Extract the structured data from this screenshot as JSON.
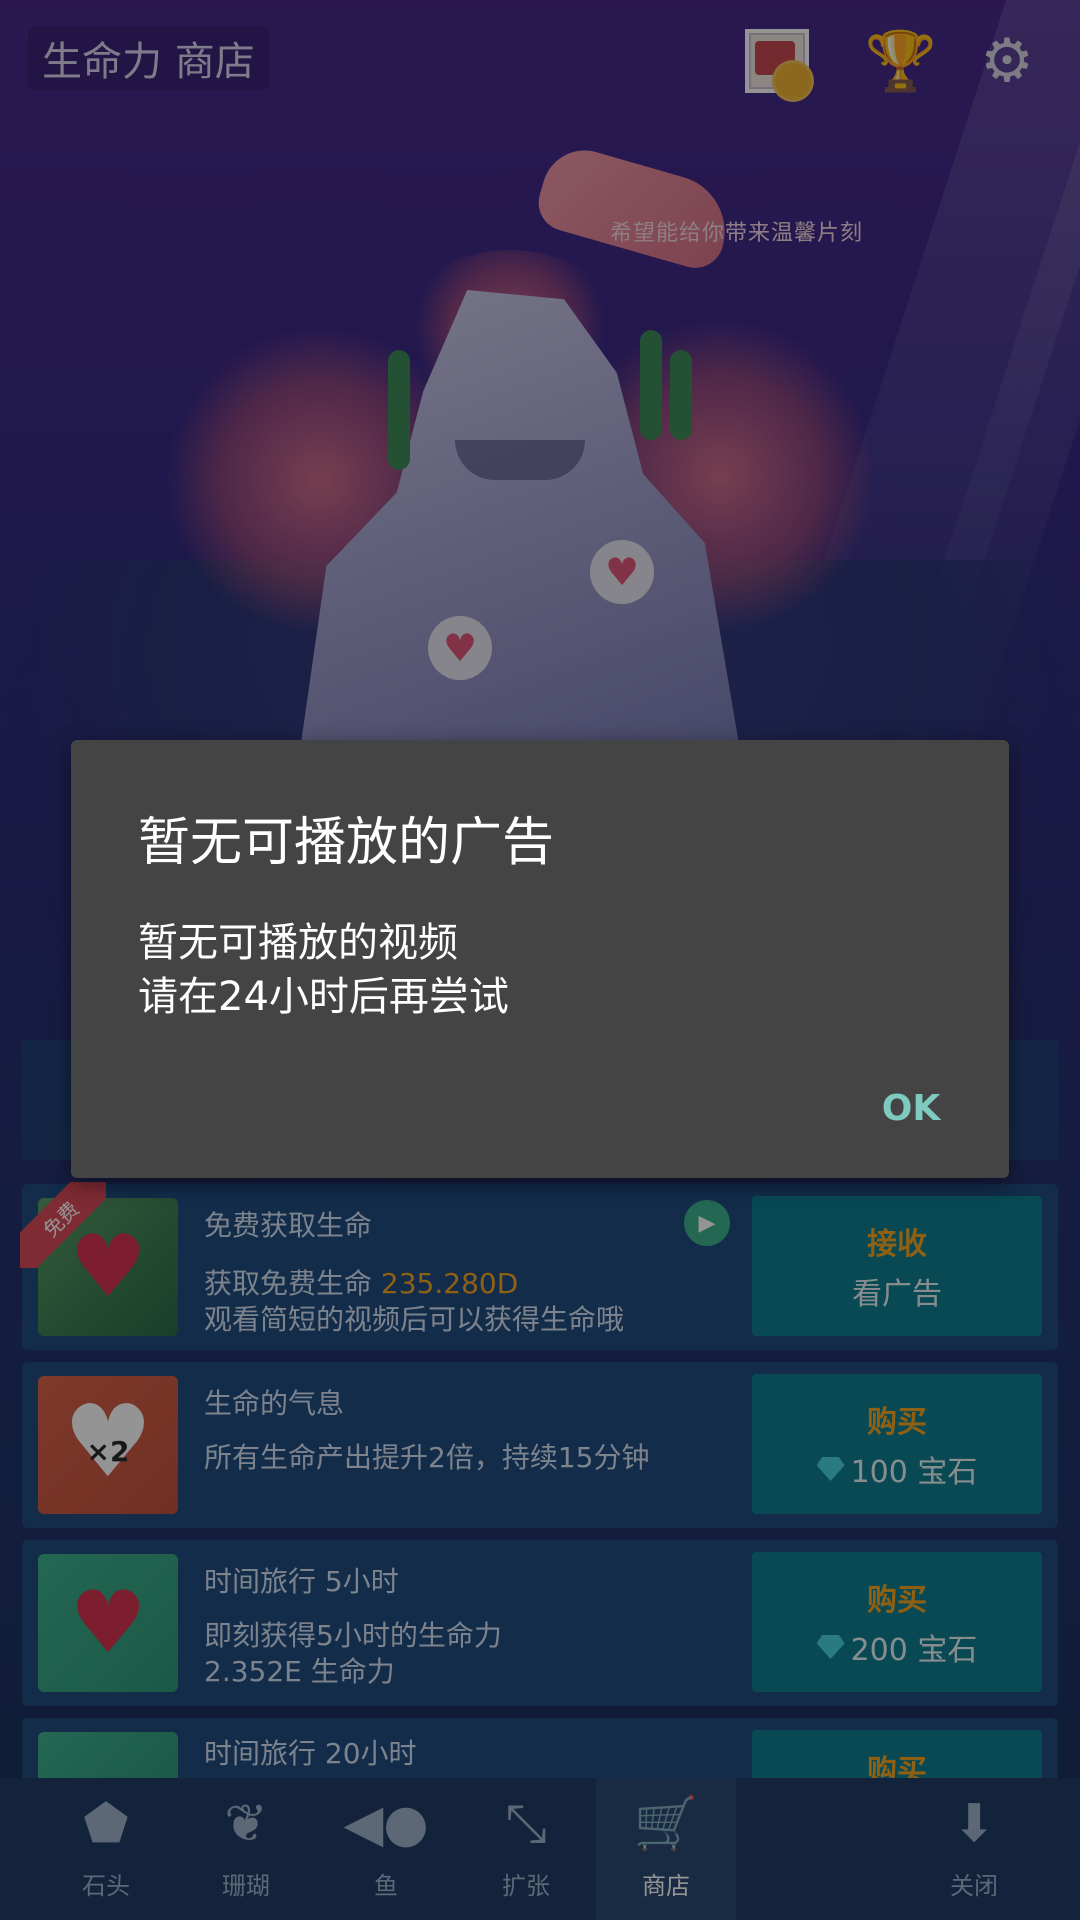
{
  "header": {
    "title": "生命力 商店"
  },
  "scene": {
    "floating_text": "希望能给你带来温馨片刻"
  },
  "dialog": {
    "title": "暂无可播放的广告",
    "message_line1": "暂无可播放的视频",
    "message_line2": "请在24小时后再尝试",
    "ok_label": "OK"
  },
  "shop": {
    "items": [
      {
        "ribbon": "免费",
        "title": "免费获取生命",
        "line1_prefix": "获取免费生命 ",
        "line1_value": "235.280D",
        "line2": "观看简短的视频后可以获得生命哦",
        "btn_top": "接收",
        "btn_bottom": "看广告"
      },
      {
        "thumb_text": "×2",
        "title": "生命的气息",
        "line1": "所有生命产出提升2倍，持续15分钟",
        "btn_top": "购买",
        "btn_bottom": "100 宝石"
      },
      {
        "title": "时间旅行 5小时",
        "line1": "即刻获得5小时的生命力",
        "line2": "2.352E 生命力",
        "btn_top": "购买",
        "btn_bottom": "200 宝石"
      },
      {
        "title": "时间旅行 20小时",
        "btn_top": "购买"
      }
    ]
  },
  "nav": {
    "items": [
      {
        "label": "石头",
        "icon": "stone-icon"
      },
      {
        "label": "珊瑚",
        "icon": "coral-icon"
      },
      {
        "label": "鱼",
        "icon": "fish-icon"
      },
      {
        "label": "扩张",
        "icon": "expand-icon"
      },
      {
        "label": "商店",
        "icon": "cart-icon",
        "active": true
      },
      {
        "label": "关闭",
        "icon": "close-down-icon"
      }
    ]
  },
  "colors": {
    "accent_teal": "#0e7f91",
    "gold": "#f5a623",
    "dialog_bg": "#444444",
    "ok_text": "#7ec9c0"
  }
}
